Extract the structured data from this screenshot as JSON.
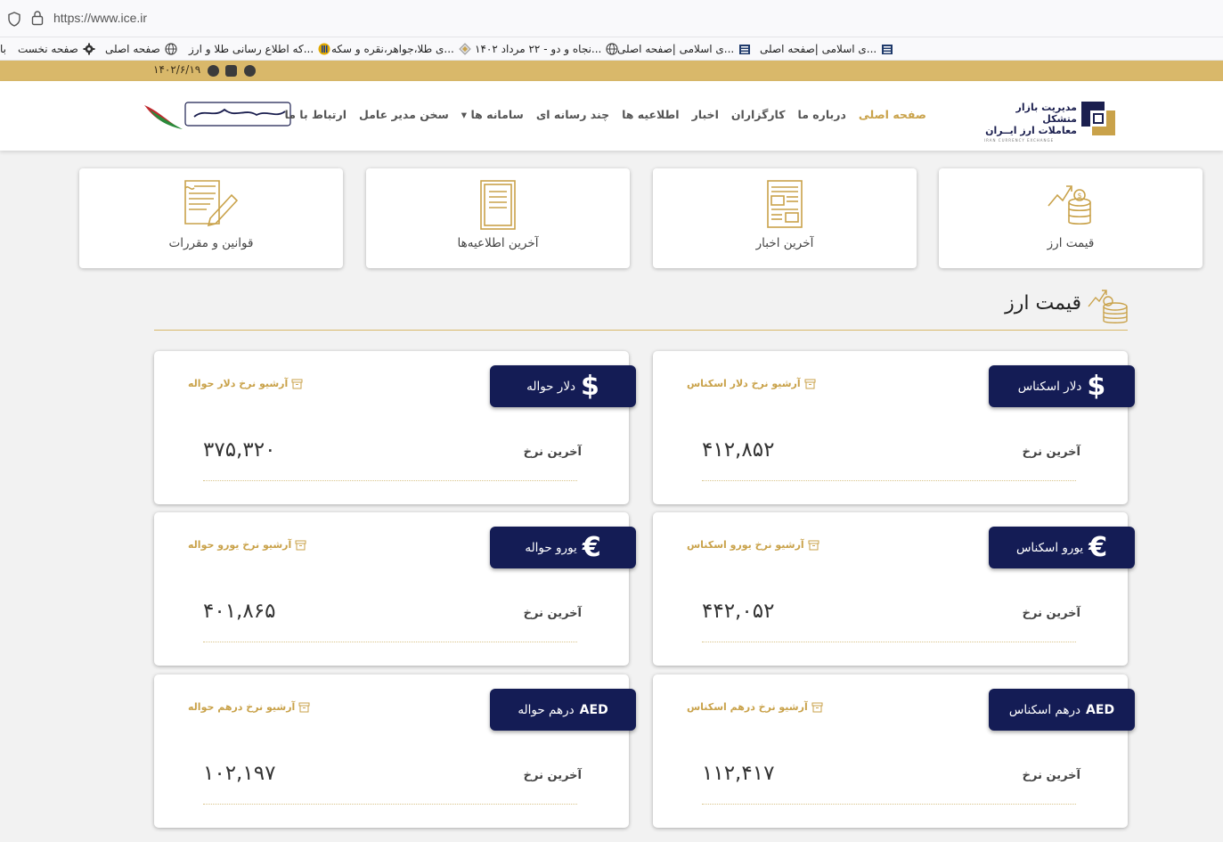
{
  "browser": {
    "url": "https://www.ice.ir",
    "bookmarks": [
      {
        "label": "با",
        "icon": "bookmark-icon"
      },
      {
        "label": "صفحه نخست",
        "icon": "gear-icon"
      },
      {
        "label": "صفحه اصلی",
        "icon": "globe-icon"
      },
      {
        "label": "...که اطلاع رسانی طلا و ارز",
        "icon": "site-icon"
      },
      {
        "label": "...ی طلا،جواهر،نقره و سکه",
        "icon": "diamond-icon"
      },
      {
        "label": "...نجاه و دو - ۲۲ مرداد ۱۴۰۲",
        "icon": "globe-icon"
      },
      {
        "label": "...ی اسلامی |صفحه اصلی",
        "icon": "building-icon"
      },
      {
        "label": "...ی اسلامی |صفحه اصلی",
        "icon": "building-icon"
      }
    ]
  },
  "topbar": {
    "date": "۱۴۰۲/۶/۱۹",
    "accent": "#d9b86a"
  },
  "header": {
    "logo": {
      "line1": "مدیریت بازار متشکل",
      "line2": "معاملات ارز ایــران",
      "line3": "IRAN CURRENCY EXCHANGE"
    },
    "nav": [
      "صفحه اصلی",
      "درباره ما",
      "کارگزاران",
      "اخبار",
      "اطلاعیه ها",
      "چند رسانه ای",
      "سامانه ها",
      "سخن مدیر عامل",
      "ارتباط با ما"
    ],
    "slogan_alt": "مهار تورم و رشد تولید"
  },
  "categories": [
    {
      "label": "قیمت ارز",
      "icon": "currency-price-icon"
    },
    {
      "label": "آخرین اخبار",
      "icon": "newspaper-icon"
    },
    {
      "label": "آخرین اطلاعیه‌ها",
      "icon": "document-icon"
    },
    {
      "label": "قوانین و مقررات",
      "icon": "contract-pen-icon"
    }
  ],
  "section": {
    "title": "قیمت ارز"
  },
  "rates": [
    {
      "name": "دلار اسکناس",
      "symbol": "$",
      "archive": "آرشیو نرخ دلار اسکناس",
      "last_label": "آخرین نرخ",
      "value": "۴۱۲,۸۵۲"
    },
    {
      "name": "دلار حواله",
      "symbol": "$",
      "archive": "آرشیو نرخ دلار حواله",
      "last_label": "آخرین نرخ",
      "value": "۳۷۵,۳۲۰"
    },
    {
      "name": "یورو اسکناس",
      "symbol": "€",
      "archive": "آرشیو نرخ یورو اسکناس",
      "last_label": "آخرین نرخ",
      "value": "۴۴۲,۰۵۲"
    },
    {
      "name": "یورو حواله",
      "symbol": "€",
      "archive": "آرشیو نرخ یورو حواله",
      "last_label": "آخرین نرخ",
      "value": "۴۰۱,۸۶۵"
    },
    {
      "name": "درهم اسکناس",
      "symbol": "AED",
      "archive": "آرشیو نرخ درهم اسکناس",
      "last_label": "آخرین نرخ",
      "value": "۱۱۲,۴۱۷"
    },
    {
      "name": "درهم حواله",
      "symbol": "AED",
      "archive": "آرشیو نرخ درهم حواله",
      "last_label": "آخرین نرخ",
      "value": "۱۰۲,۱۹۷"
    }
  ],
  "colors": {
    "navy": "#141c55",
    "gold": "#c9a24a"
  }
}
